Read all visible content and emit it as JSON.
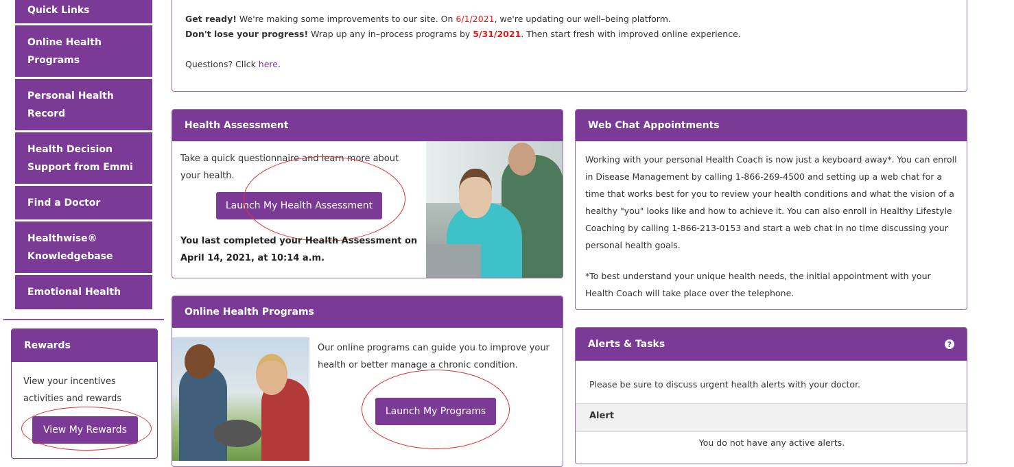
{
  "sidebar": {
    "items": [
      {
        "label": "Quick Links"
      },
      {
        "label": "Online Health Programs"
      },
      {
        "label": "Personal Health Record"
      },
      {
        "label": "Health Decision Support from Emmi"
      },
      {
        "label": "Find a Doctor"
      },
      {
        "label": "Healthwise® Knowledgebase"
      },
      {
        "label": "Emotional Health"
      }
    ]
  },
  "rewards": {
    "title": "Rewards",
    "text": "View your incentives activities and rewards",
    "button": "View My Rewards"
  },
  "notice": {
    "line1_bold": "Get ready!",
    "line1_a": " We're making some improvements to our site. On ",
    "line1_date": "6/1/2021",
    "line1_b": ", we're updating our well–being platform.",
    "line2_bold": "Don't lose your progress!",
    "line2_a": " Wrap up any in–process programs by ",
    "line2_date": "5/31/2021",
    "line2_b": ". Then start fresh with improved online experience.",
    "questions": "Questions? Click ",
    "link": "here",
    "after_link": "."
  },
  "health_assessment": {
    "title": "Health Assessment",
    "text": "Take a quick questionnaire and learn more about your health.",
    "button": "Launch My Health Assessment",
    "completed": "You last completed your Health Assessment on April 14, 2021, at 10:14 a.m."
  },
  "web_chat": {
    "title": "Web Chat Appointments",
    "para1": "Working with your personal Health Coach is now just a keyboard away*.  You can enroll in Disease Management by calling 1-866-269-4500 and setting up a web chat for a time that works best for you to review your health conditions and what the vision of a healthy \"you\" looks like and how to achieve it.  You can also enroll in Healthy Lifestyle Coaching by calling 1-866-213-0153 and start a web chat in no time discussing your personal health goals.",
    "para2": "*To best understand your unique health needs, the initial appointment with your Health Coach will take place over the telephone."
  },
  "programs": {
    "title": "Online Health Programs",
    "text": "Our online programs can guide you to improve your health or better manage a chronic condition.",
    "button": "Launch My Programs"
  },
  "alerts": {
    "title": "Alerts & Tasks",
    "help_icon": "?",
    "text": "Please be sure to discuss urgent health alerts with your doctor.",
    "col_header": "Alert",
    "empty": "You do not have any active alerts."
  }
}
